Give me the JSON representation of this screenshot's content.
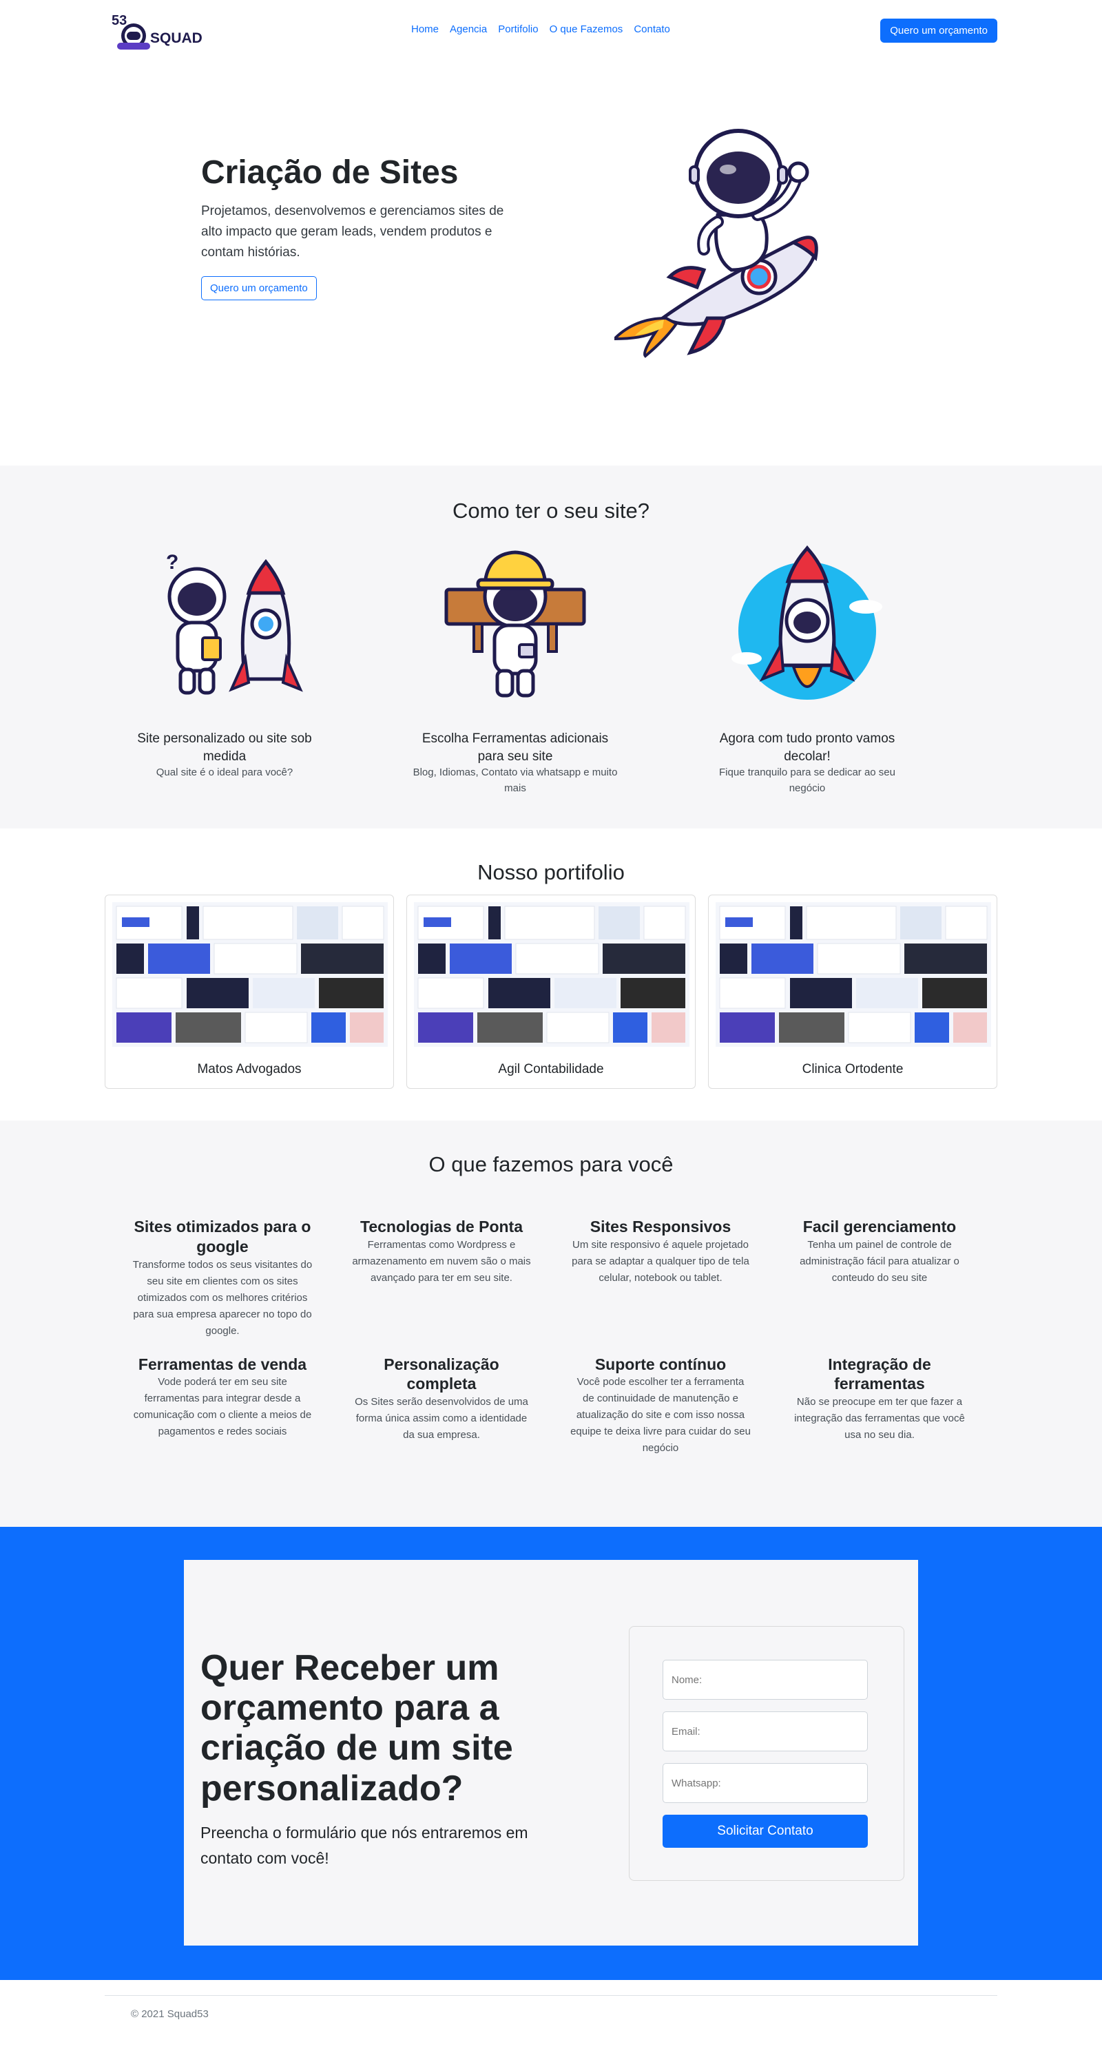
{
  "brand": {
    "logo_number": "53",
    "logo_word": "SQUAD"
  },
  "nav": {
    "links": [
      "Home",
      "Agencia",
      "Portifolio",
      "O que Fazemos",
      "Contato"
    ],
    "cta": "Quero um orçamento"
  },
  "hero": {
    "title": "Criação de Sites",
    "lead": "Projetamos, desenvolvemos e gerenciamos sites de alto impacto que geram leads, vendem produtos e contam histórias.",
    "button": "Quero um orçamento"
  },
  "steps": {
    "title": "Como ter o seu site?",
    "items": [
      {
        "title": "Site personalizado ou site sob medida",
        "text": "Qual site é o ideal para você?"
      },
      {
        "title": "Escolha Ferramentas adicionais para seu site",
        "text": "Blog, Idiomas, Contato via whatsapp e muito mais"
      },
      {
        "title": "Agora com tudo pronto vamos decolar!",
        "text": "Fique tranquilo para se dedicar ao seu negócio"
      }
    ]
  },
  "portfolio": {
    "title": "Nosso portifolio",
    "items": [
      "Matos Advogados",
      "Agil Contabilidade",
      "Clinica Ortodente"
    ]
  },
  "services": {
    "title": "O que fazemos para você",
    "items": [
      {
        "title": "Sites otimizados para o google",
        "text": "Transforme todos os seus visitantes do seu site em clientes com os sites otimizados com os melhores critérios para sua empresa aparecer no topo do google."
      },
      {
        "title": "Tecnologias de Ponta",
        "text": "Ferramentas como Wordpress e armazenamento em nuvem são o mais avançado para ter em seu site."
      },
      {
        "title": "Sites Responsivos",
        "text": "Um site responsivo é aquele projetado para se adaptar a qualquer tipo de tela celular, notebook ou tablet."
      },
      {
        "title": "Facil gerenciamento",
        "text": "Tenha um painel de controle de administração fácil para atualizar o conteudo do seu site"
      },
      {
        "title": "Ferramentas de venda",
        "text": "Vode poderá ter em seu site ferramentas para integrar desde a comunicação com o cliente a meios de pagamentos e redes sociais"
      },
      {
        "title": "Personalização completa",
        "text": "Os Sites serão desenvolvidos de uma forma única assim como a identidade da sua empresa."
      },
      {
        "title": "Suporte contínuo",
        "text": "Você pode escolher ter a ferramenta de continuidade de manutenção e atualização do site e com isso nossa equipe te deixa livre para cuidar do seu negócio"
      },
      {
        "title": "Integração de ferramentas",
        "text": "Não se preocupe em ter que fazer a integração das ferramentas que você usa no seu dia."
      }
    ]
  },
  "cta": {
    "title": "Quer Receber um orçamento para a criação de um site personalizado?",
    "lead": "Preencha o formulário que nós entraremos em contato com você!",
    "form": {
      "name_placeholder": "Nome:",
      "email_placeholder": "Email:",
      "whatsapp_placeholder": "Whatsapp:",
      "submit": "Solicitar Contato"
    }
  },
  "footer": {
    "copyright": "© 2021 Squad53"
  },
  "colors": {
    "primary": "#0d6efd",
    "section_bg": "#f6f6f8",
    "text": "#212529"
  }
}
